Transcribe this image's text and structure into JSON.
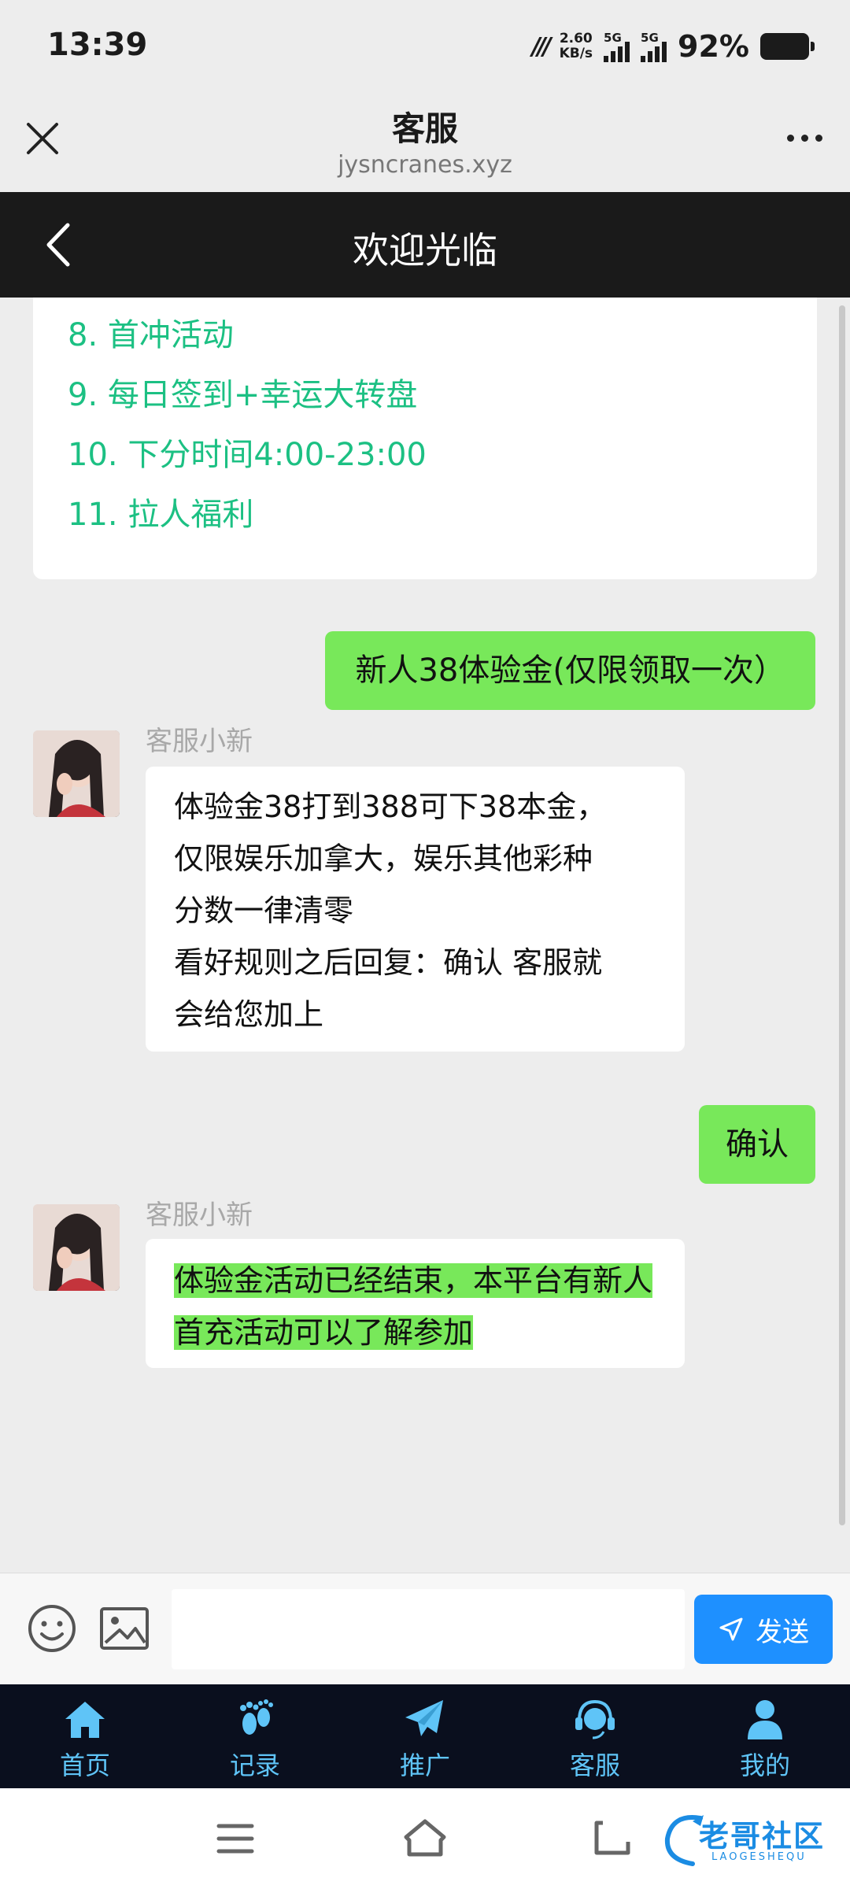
{
  "status": {
    "time": "13:39",
    "speed_value": "2.60",
    "speed_unit": "KB/s",
    "sim1": "5G",
    "sim2": "5G",
    "battery": "92%"
  },
  "browser": {
    "title": "客服",
    "url": "jysncranes.xyz"
  },
  "app": {
    "title": "欢迎光临"
  },
  "chat": {
    "menu_items": [
      "8. 首冲活动",
      "9. 每日签到+幸运大转盘",
      "10. 下分时间4:00-23:00",
      "11. 拉人福利"
    ],
    "user_msg_1": "新人38体验金(仅限领取一次）",
    "agent_name_1": "客服小新",
    "agent_msg_1": [
      "体验金38打到388可下38本金，",
      "仅限娱乐加拿大，娱乐其他彩种",
      "分数一律清零",
      "看好规则之后回复：确认 客服就",
      "会给您加上"
    ],
    "user_msg_2": "确认",
    "agent_name_2": "客服小新",
    "agent_msg_2": [
      "体验金活动已经结束，本平台有新人",
      "首充活动可以了解参加"
    ]
  },
  "input": {
    "placeholder": "",
    "send_label": "发送"
  },
  "tabs": [
    {
      "label": "首页",
      "icon": "home-icon"
    },
    {
      "label": "记录",
      "icon": "footprint-icon"
    },
    {
      "label": "推广",
      "icon": "paper-plane-icon"
    },
    {
      "label": "客服",
      "icon": "headset-icon"
    },
    {
      "label": "我的",
      "icon": "user-icon"
    }
  ],
  "watermark": {
    "text": "老哥社区",
    "sub": "LAOGESHEQU"
  },
  "colors": {
    "menu_green": "#1cc083",
    "bubble_green": "#78e85a",
    "tab_blue": "#5fc4f7",
    "send_blue": "#1e90ff"
  }
}
